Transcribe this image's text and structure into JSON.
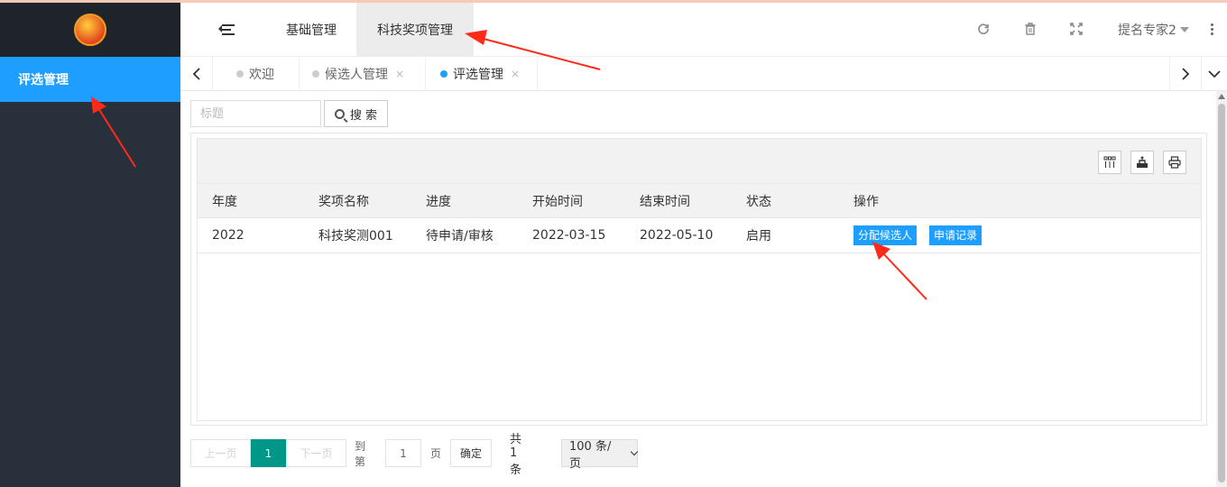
{
  "sidebar": {
    "logo_text": "",
    "items": [
      {
        "label": "评选管理"
      }
    ]
  },
  "header": {
    "tabs": [
      {
        "label": "基础管理"
      },
      {
        "label": "科技奖项管理"
      }
    ],
    "user": "提名专家2",
    "icons": [
      "refresh-icon",
      "trash-icon",
      "fullscreen-icon",
      "more-icon"
    ]
  },
  "tabbar": {
    "tabs": [
      {
        "label": "欢迎",
        "closable": false
      },
      {
        "label": "候选人管理",
        "closable": true
      },
      {
        "label": "评选管理",
        "closable": true
      }
    ],
    "close_glyph": "×"
  },
  "search": {
    "placeholder": "标题",
    "button_label": "搜 索"
  },
  "table": {
    "toolbar_icons": [
      "columns-icon",
      "export-icon",
      "print-icon"
    ],
    "columns": [
      "年度",
      "奖项名称",
      "进度",
      "开始时间",
      "结束时间",
      "状态",
      "操作"
    ],
    "rows": [
      {
        "year": "2022",
        "name": "科技奖测001",
        "progress": "待申请/审核",
        "start": "2022-03-15",
        "end": "2022-05-10",
        "status": "启用",
        "actions": [
          "分配候选人",
          "申请记录"
        ]
      }
    ]
  },
  "pager": {
    "prev": "上一页",
    "current": "1",
    "next": "下一页",
    "goto_label": "到第",
    "goto_value": "1",
    "page_unit": "页",
    "confirm": "确定",
    "total": "共 1 条",
    "page_size": "100 条/页"
  },
  "colors": {
    "accent": "#1e9fff",
    "sidebar": "#28303b",
    "pager_active": "#009688",
    "annotation": "#ff2a1a"
  }
}
